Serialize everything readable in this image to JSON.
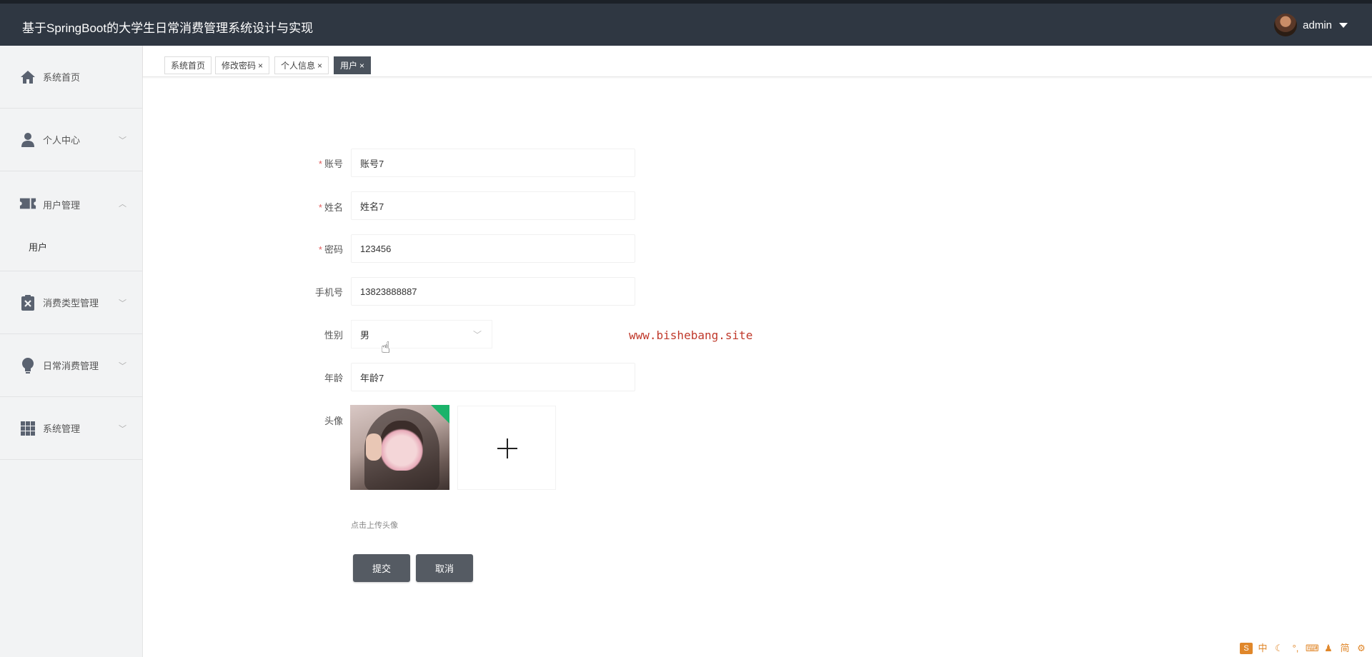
{
  "header": {
    "title": "基于SpringBoot的大学生日常消费管理系统设计与实现",
    "user": "admin"
  },
  "sidebar": {
    "items": [
      {
        "label": "系统首页",
        "icon": "home-icon"
      },
      {
        "label": "个人中心",
        "icon": "user-icon"
      },
      {
        "label": "用户管理",
        "icon": "ticket-icon",
        "expanded": true,
        "children": [
          {
            "label": "用户"
          }
        ]
      },
      {
        "label": "消费类型管理",
        "icon": "clipboard-x-icon"
      },
      {
        "label": "日常消费管理",
        "icon": "bulb-icon"
      },
      {
        "label": "系统管理",
        "icon": "grid-icon"
      }
    ]
  },
  "tabs": [
    {
      "label": "系统首页",
      "closable": false,
      "active": false
    },
    {
      "label": "修改密码",
      "closable": true,
      "active": false
    },
    {
      "label": "个人信息",
      "closable": true,
      "active": false
    },
    {
      "label": "用户",
      "closable": true,
      "active": true
    }
  ],
  "form": {
    "account": {
      "label": "账号",
      "required": true,
      "value": "账号7"
    },
    "name": {
      "label": "姓名",
      "required": true,
      "value": "姓名7"
    },
    "password": {
      "label": "密码",
      "required": true,
      "value": "123456"
    },
    "phone": {
      "label": "手机号",
      "required": false,
      "value": "13823888887"
    },
    "gender": {
      "label": "性别",
      "required": false,
      "value": "男"
    },
    "age": {
      "label": "年龄",
      "required": false,
      "value": "年龄7"
    },
    "avatar": {
      "label": "头像",
      "hint": "点击上传头像"
    },
    "submit_label": "提交",
    "cancel_label": "取消"
  },
  "watermark": "www.bishebang.site",
  "ime": [
    "中",
    "简"
  ],
  "close_glyph": "×",
  "colors": {
    "header_bg": "#2f3742",
    "active_tab": "#4a525c",
    "button": "#555b63",
    "required": "#e25c5c"
  }
}
